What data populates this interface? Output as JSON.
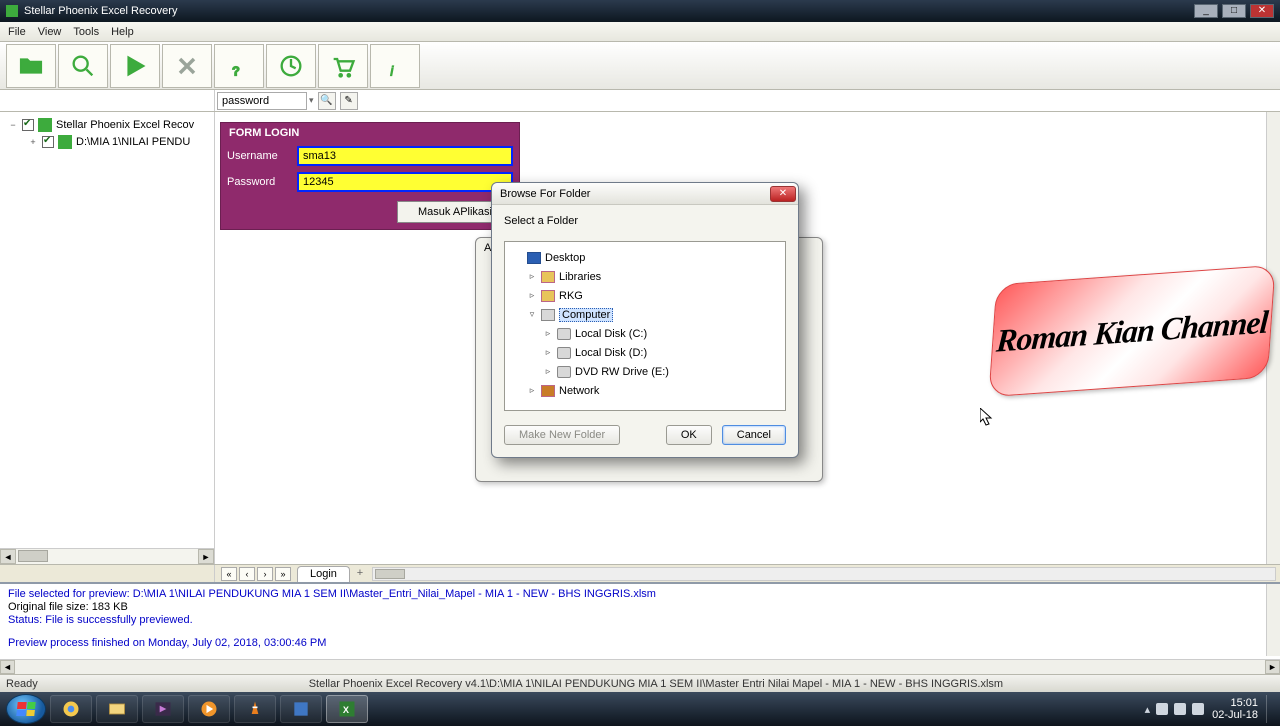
{
  "app": {
    "title": "Stellar Phoenix Excel Recovery"
  },
  "menu": {
    "file": "File",
    "view": "View",
    "tools": "Tools",
    "help": "Help"
  },
  "search": {
    "value": "password"
  },
  "tree": {
    "root": "Stellar Phoenix Excel Recov",
    "child": "D:\\MIA 1\\NILAI PENDU"
  },
  "form": {
    "title": "FORM LOGIN",
    "username_label": "Username",
    "username_value": "sma13",
    "password_label": "Password",
    "password_value": "12345",
    "submit": "Masuk APlikasi"
  },
  "behind_dialog": {
    "title_fragment": "Ad"
  },
  "browse": {
    "title": "Browse For Folder",
    "instruction": "Select a Folder",
    "nodes": {
      "desktop": "Desktop",
      "libraries": "Libraries",
      "rkg": "RKG",
      "computer": "Computer",
      "c": "Local Disk (C:)",
      "d": "Local Disk (D:)",
      "e": "DVD RW Drive (E:)",
      "network": "Network"
    },
    "make_new": "Make New Folder",
    "ok": "OK",
    "cancel": "Cancel"
  },
  "sheet": {
    "tab": "Login"
  },
  "log": {
    "l1": "File selected for preview: D:\\MIA 1\\NILAI PENDUKUNG MIA 1 SEM II\\Master_Entri_Nilai_Mapel - MIA 1 - NEW - BHS INGGRIS.xlsm",
    "l2": "Original file size: 183 KB",
    "l3": "Status: File is successfully previewed.",
    "l4": "Preview process finished on Monday, July 02, 2018, 03:00:46 PM"
  },
  "status": {
    "ready": "Ready",
    "path": "Stellar Phoenix Excel Recovery v4.1\\D:\\MIA 1\\NILAI PENDUKUNG MIA 1 SEM II\\Master Entri Nilai Mapel - MIA 1 - NEW - BHS INGGRIS.xlsm"
  },
  "sys": {
    "time": "15:01",
    "date": "02-Jul-18"
  },
  "watermark": "Roman Kian Channel"
}
